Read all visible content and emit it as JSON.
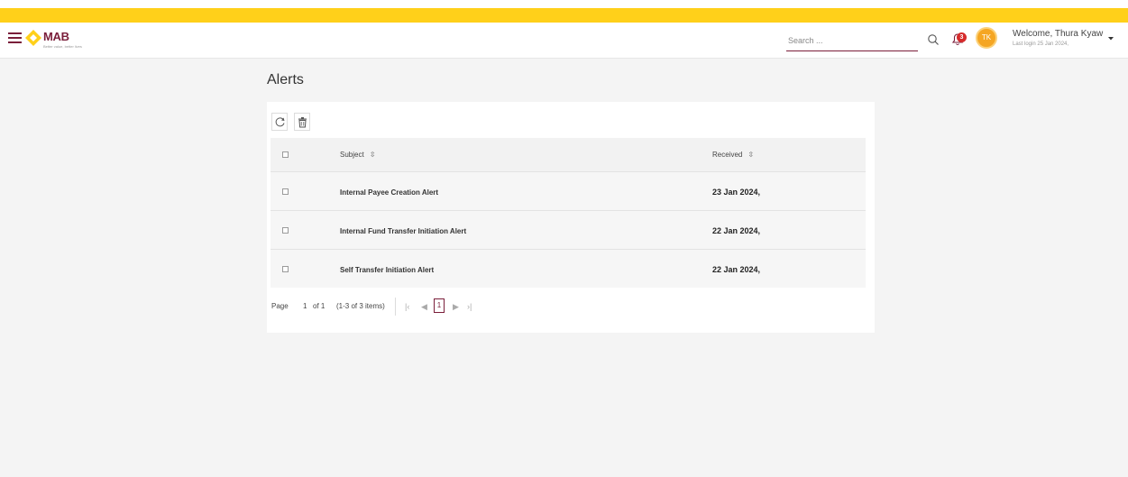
{
  "header": {
    "logo_text": "MAB",
    "logo_tagline": "Better value, better lives",
    "search": {
      "placeholder": "Search ...",
      "value": ""
    },
    "notification_count": "3",
    "avatar_initials": "TK",
    "welcome": "Welcome, Thura Kyaw",
    "last_login": "Last login 25 Jan 2024,"
  },
  "colors": {
    "accent_yellow": "#ffd01a",
    "brand_maroon": "#7a1e3a",
    "badge_red": "#d62b2b",
    "avatar_orange": "#f5a623"
  },
  "icons": {
    "menu": "hamburger-icon",
    "logo": "diamond-logo-icon",
    "search": "search-icon",
    "notifications": "bell-icon",
    "user_menu": "caret-down-icon",
    "refresh": "refresh-icon",
    "delete": "trash-icon"
  },
  "page": {
    "title": "Alerts"
  },
  "table": {
    "columns": {
      "subject": "Subject",
      "received": "Received"
    },
    "rows": [
      {
        "subject": "Internal Payee Creation Alert",
        "received": "23 Jan 2024,"
      },
      {
        "subject": "Internal Fund Transfer Initiation Alert",
        "received": "22 Jan 2024,"
      },
      {
        "subject": "Self Transfer Initiation Alert",
        "received": "22 Jan 2024,"
      }
    ]
  },
  "pager": {
    "page_label": "Page",
    "page_number": "1",
    "of_label": "of 1",
    "items_label": "(1-3 of 3 items)",
    "current": "1"
  }
}
